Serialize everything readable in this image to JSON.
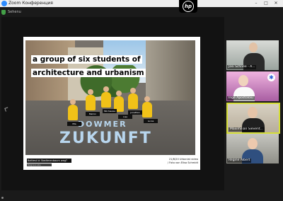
{
  "window": {
    "title": "Zoom Конференция",
    "min_glyph": "–",
    "max_glyph": "□",
    "close_glyph": "✕"
  },
  "hp_logo": "hp",
  "topline": {
    "label": "Sehenu"
  },
  "slide": {
    "heading_line1": "a group of six students of",
    "heading_line2": "architecture and urbanism",
    "chalk_line1": "DOWMER",
    "chalk_line2": "ZUKUNFT",
    "caption_left": "Baltiest bi Stadtmenbaum weg?",
    "caption_left_sub": "Belgrave ebe",
    "caption_right_line1": "21/8/20 Urbanist video",
    "caption_right_line2": "/ Foto von Elisa Schmidt",
    "signs": [
      "Marlon",
      "Milchweiss",
      "Lisa",
      "Jonathan",
      "Mia",
      "Lucas"
    ]
  },
  "participants": [
    {
      "name": "Josi Schnee - A..."
    },
    {
      "name": "Inge Apostoloiu"
    },
    {
      "name": "Maximilian Sievent..."
    },
    {
      "name": "Regine Albert"
    }
  ],
  "colors": {
    "accent": "#2d8cff",
    "active_speaker_border": "#d4dd37",
    "vest_yellow": "#f1c218",
    "chalk_blue": "#b8d6ee"
  }
}
